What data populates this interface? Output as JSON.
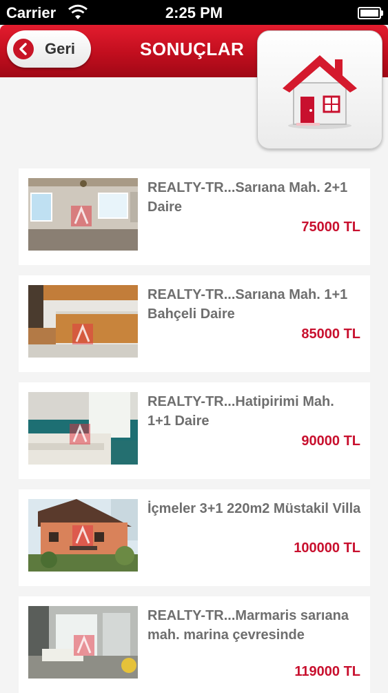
{
  "status_bar": {
    "carrier": "Carrier",
    "time": "2:25 PM"
  },
  "nav": {
    "back_label": "Geri",
    "title": "SONUÇLAR"
  },
  "listings": [
    {
      "title": "REALTY-TR...Sarıana Mah. 2+1 Daire",
      "price": "75000 TL"
    },
    {
      "title": "REALTY-TR...Sarıana Mah. 1+1 Bahçeli Daire",
      "price": "85000 TL"
    },
    {
      "title": "REALTY-TR...Hatipirimi Mah. 1+1 Daire",
      "price": "90000 TL"
    },
    {
      "title": "İçmeler 3+1 220m2 Müstakil Villa",
      "price": "100000 TL"
    },
    {
      "title": "REALTY-TR...Marmaris sarıana mah. marina çevresinde",
      "price": "119000 TL"
    }
  ],
  "colors": {
    "accent": "#c8102e",
    "nav_red": "#c10e1e",
    "text_gray": "#6e6e6e"
  },
  "icons": {
    "back": "chevron-left-icon",
    "home": "house-icon",
    "wifi": "wifi-icon",
    "battery": "battery-icon"
  }
}
